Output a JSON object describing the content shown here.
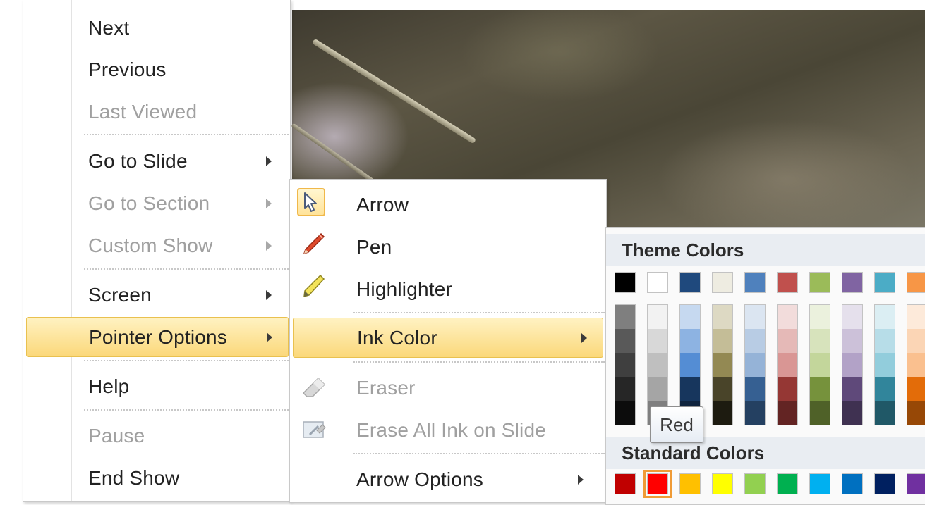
{
  "main_menu": {
    "items": [
      {
        "label": "Next",
        "enabled": true,
        "submenu": false
      },
      {
        "label": "Previous",
        "enabled": true,
        "submenu": false
      },
      {
        "label": "Last Viewed",
        "enabled": false,
        "submenu": false
      },
      {
        "label": "Go to Slide",
        "enabled": true,
        "submenu": true
      },
      {
        "label": "Go to Section",
        "enabled": false,
        "submenu": true
      },
      {
        "label": "Custom Show",
        "enabled": false,
        "submenu": true
      },
      {
        "label": "Screen",
        "enabled": true,
        "submenu": true
      },
      {
        "label": "Pointer Options",
        "enabled": true,
        "submenu": true,
        "highlighted": true
      },
      {
        "label": "Help",
        "enabled": true,
        "submenu": false
      },
      {
        "label": "Pause",
        "enabled": false,
        "submenu": false
      },
      {
        "label": "End Show",
        "enabled": true,
        "submenu": false
      }
    ]
  },
  "pointer_menu": {
    "items": [
      {
        "label": "Arrow",
        "icon": "arrow-cursor-icon",
        "enabled": true,
        "selected": true
      },
      {
        "label": "Pen",
        "icon": "pen-icon",
        "enabled": true
      },
      {
        "label": "Highlighter",
        "icon": "highlighter-icon",
        "enabled": true
      },
      {
        "label": "Ink Color",
        "enabled": true,
        "submenu": true,
        "highlighted": true
      },
      {
        "label": "Eraser",
        "icon": "eraser-icon",
        "enabled": false
      },
      {
        "label": "Erase All Ink on Slide",
        "icon": "erase-all-icon",
        "enabled": false
      },
      {
        "label": "Arrow Options",
        "enabled": true,
        "submenu": true
      }
    ]
  },
  "color_menu": {
    "theme_header": "Theme Colors",
    "standard_header": "Standard Colors",
    "theme_top": [
      "#000000",
      "#ffffff",
      "#1f497d",
      "#eeece1",
      "#4f81bd",
      "#c0504d",
      "#9bbb59",
      "#8064a2",
      "#4bacc6",
      "#f79646"
    ],
    "theme_shades": [
      [
        "#7f7f7f",
        "#595959",
        "#3f3f3f",
        "#262626",
        "#0c0c0c"
      ],
      [
        "#f2f2f2",
        "#d8d8d8",
        "#bfbfbf",
        "#a5a5a5",
        "#7f7f7f"
      ],
      [
        "#c6d9f0",
        "#8db3e2",
        "#548dd4",
        "#17365d",
        "#0f243e"
      ],
      [
        "#ddd9c3",
        "#c4bd97",
        "#938953",
        "#494429",
        "#1d1b10"
      ],
      [
        "#dbe5f1",
        "#b8cce4",
        "#95b3d7",
        "#366092",
        "#244061"
      ],
      [
        "#f2dcdb",
        "#e5b9b7",
        "#d99694",
        "#953734",
        "#632423"
      ],
      [
        "#ebf1dd",
        "#d7e3bc",
        "#c3d69b",
        "#76923c",
        "#4f6128"
      ],
      [
        "#e5e0ec",
        "#ccc1d9",
        "#b2a2c7",
        "#5f497a",
        "#3f3151"
      ],
      [
        "#dbeef3",
        "#b7dde8",
        "#92cddc",
        "#31859b",
        "#205867"
      ],
      [
        "#fdeada",
        "#fbd5b5",
        "#fac08f",
        "#e36c09",
        "#974806"
      ]
    ],
    "standard": [
      "#c00000",
      "#ff0000",
      "#ffc000",
      "#ffff00",
      "#92d050",
      "#00b050",
      "#00b0f0",
      "#0070c0",
      "#002060",
      "#7030a0"
    ],
    "selected_standard_index": 1
  },
  "tooltip": {
    "text": "Red"
  }
}
